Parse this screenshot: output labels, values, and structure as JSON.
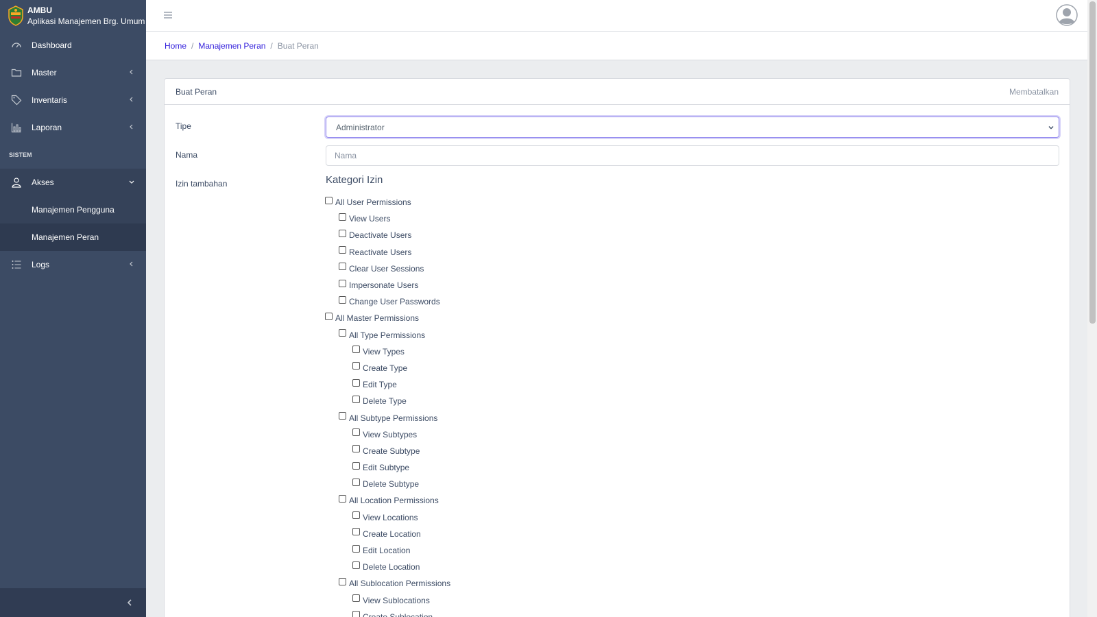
{
  "brand": {
    "name": "AMBU",
    "subtitle": "Aplikasi Manajemen Brg. Umum"
  },
  "sidebar": {
    "items": [
      {
        "label": "Dashboard",
        "icon": "speedometer-icon"
      },
      {
        "label": "Master",
        "icon": "folder-icon"
      },
      {
        "label": "Inventaris",
        "icon": "tag-icon"
      },
      {
        "label": "Laporan",
        "icon": "chart-bar-icon"
      }
    ],
    "section_title": "SISTEM",
    "akses": {
      "label": "Akses",
      "icon": "user-icon"
    },
    "akses_sub": [
      "Manajemen Pengguna",
      "Manajemen Peran"
    ],
    "logs": {
      "label": "Logs",
      "icon": "list-icon"
    }
  },
  "breadcrumb": {
    "home": "Home",
    "parent": "Manajemen Peran",
    "current": "Buat Peran",
    "separator": "/"
  },
  "card": {
    "title": "Buat Peran",
    "cancel": "Membatalkan",
    "tipe_label": "Tipe",
    "tipe_value": "Administrator",
    "nama_label": "Nama",
    "nama_placeholder": "Nama",
    "izin_label": "Izin tambahan",
    "kategori_title": "Kategori Izin"
  },
  "permissions": [
    {
      "label": "All User Permissions",
      "level": 0
    },
    {
      "label": "View Users",
      "level": 1
    },
    {
      "label": "Deactivate Users",
      "level": 1
    },
    {
      "label": "Reactivate Users",
      "level": 1
    },
    {
      "label": "Clear User Sessions",
      "level": 1
    },
    {
      "label": "Impersonate Users",
      "level": 1
    },
    {
      "label": "Change User Passwords",
      "level": 1
    },
    {
      "label": "All Master Permissions",
      "level": 0
    },
    {
      "label": "All Type Permissions",
      "level": 1
    },
    {
      "label": "View Types",
      "level": 2
    },
    {
      "label": "Create Type",
      "level": 2
    },
    {
      "label": "Edit Type",
      "level": 2
    },
    {
      "label": "Delete Type",
      "level": 2
    },
    {
      "label": "All Subtype Permissions",
      "level": 1
    },
    {
      "label": "View Subtypes",
      "level": 2
    },
    {
      "label": "Create Subtype",
      "level": 2
    },
    {
      "label": "Edit Subtype",
      "level": 2
    },
    {
      "label": "Delete Subtype",
      "level": 2
    },
    {
      "label": "All Location Permissions",
      "level": 1
    },
    {
      "label": "View Locations",
      "level": 2
    },
    {
      "label": "Create Location",
      "level": 2
    },
    {
      "label": "Edit Location",
      "level": 2
    },
    {
      "label": "Delete Location",
      "level": 2
    },
    {
      "label": "All Sublocation Permissions",
      "level": 1
    },
    {
      "label": "View Sublocations",
      "level": 2
    },
    {
      "label": "Create Sublocation",
      "level": 2
    }
  ],
  "colors": {
    "sidebar": "#3c4b64",
    "link": "#321fdb",
    "focus_border": "#958bef"
  }
}
